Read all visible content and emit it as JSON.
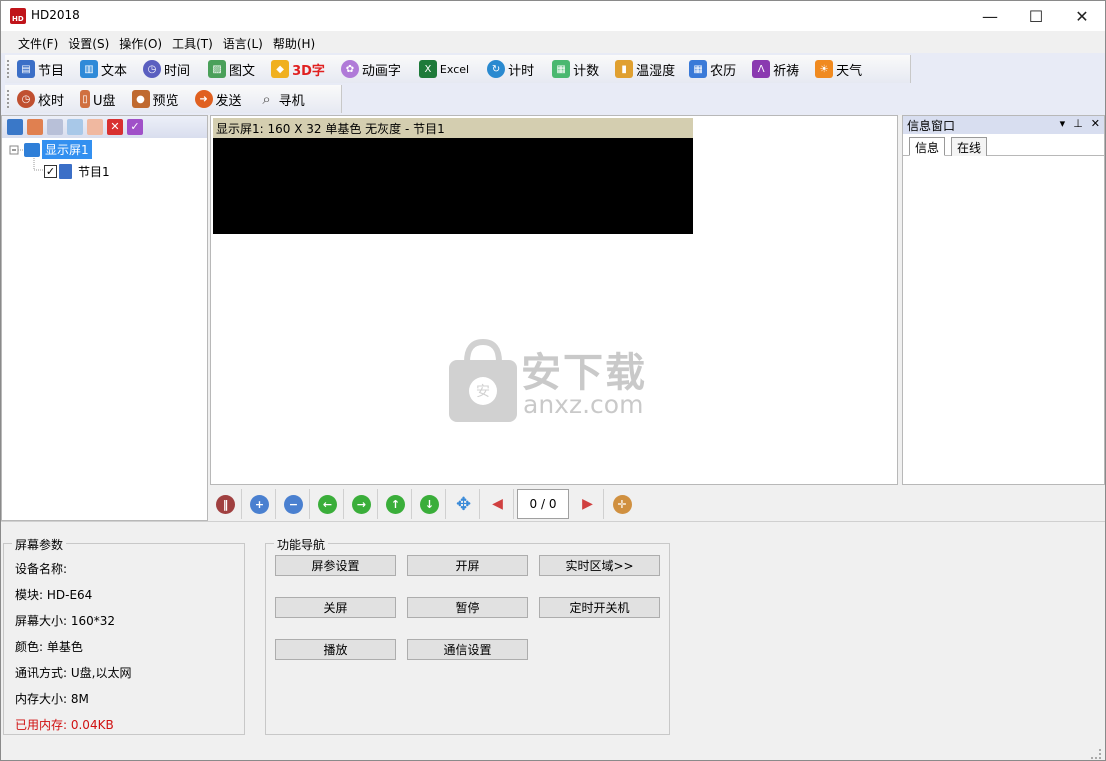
{
  "window": {
    "title": "HD2018",
    "logo_text": "HD",
    "controls": {
      "minimize": "—",
      "maximize": "☐",
      "close": "✕"
    }
  },
  "menu": [
    "文件(F)",
    "设置(S)",
    "操作(O)",
    "工具(T)",
    "语言(L)",
    "帮助(H)"
  ],
  "toolbar1": [
    {
      "label": "节目",
      "icon": "program-icon",
      "color": "#3b6fc7"
    },
    {
      "label": "文本",
      "icon": "book-icon",
      "color": "#2f8ad8"
    },
    {
      "label": "时间",
      "icon": "clock-icon",
      "color": "#5a5fc0"
    },
    {
      "label": "图文",
      "icon": "picture-icon",
      "color": "#4aa05a"
    },
    {
      "label": "3D字",
      "icon": "cube-icon",
      "color": "#f0b020",
      "label_color": "#e02020"
    },
    {
      "label": "动画字",
      "icon": "flower-icon",
      "color": "#b07ad8"
    },
    {
      "label": "Excel",
      "icon": "excel-icon",
      "color": "#1e7a3a"
    },
    {
      "label": "计时",
      "icon": "timer-icon",
      "color": "#2a8ad0"
    },
    {
      "label": "计数",
      "icon": "counter-icon",
      "color": "#4ab870"
    },
    {
      "label": "温湿度",
      "icon": "thermometer-icon",
      "color": "#e0a030"
    },
    {
      "label": "农历",
      "icon": "calendar-icon",
      "color": "#3a7ad8"
    },
    {
      "label": "祈祷",
      "icon": "pray-icon",
      "color": "#8a3ab0"
    },
    {
      "label": "天气",
      "icon": "weather-icon",
      "color": "#f08a20"
    }
  ],
  "toolbar2": [
    {
      "label": "校时",
      "icon": "sync-clock-icon",
      "color": "#c05030"
    },
    {
      "label": "U盘",
      "icon": "usb-icon",
      "color": "#d07040"
    },
    {
      "label": "预览",
      "icon": "camera-icon",
      "color": "#c06a30"
    },
    {
      "label": "发送",
      "icon": "send-icon",
      "color": "#e06020"
    },
    {
      "label": "寻机",
      "icon": "magnifier-icon",
      "color": "#707070"
    }
  ],
  "tree": {
    "root_label": "显示屏1",
    "child_label": "节目1",
    "child_checked": "✓"
  },
  "canvas": {
    "screen_header": "显示屏1: 160 X 32  单基色 无灰度 - 节目1"
  },
  "info_panel": {
    "title": "信息窗口",
    "header_icons": [
      "▾",
      "⊥",
      "✕"
    ],
    "tabs": [
      "信息",
      "在线"
    ]
  },
  "nav": {
    "page_indicator": "0 / 0"
  },
  "screen_params": {
    "group_title": "屏幕参数",
    "device_name": "设备名称:",
    "module": "模块: HD-E64",
    "screen_size": "屏幕大小: 160*32",
    "color": "颜色: 单基色",
    "comm": "通讯方式: U盘,以太网",
    "memory": "内存大小: 8M",
    "used_memory": "已用内存: 0.04KB",
    "used_memory_color": "#d01010"
  },
  "function_nav": {
    "group_title": "功能导航",
    "buttons": [
      "屏参设置",
      "开屏",
      "实时区域>>",
      "关屏",
      "暂停",
      "定时开关机",
      "播放",
      "通信设置"
    ]
  },
  "watermark": {
    "text_cn": "安下载",
    "text_en": "anxz.com",
    "badge": "安"
  }
}
